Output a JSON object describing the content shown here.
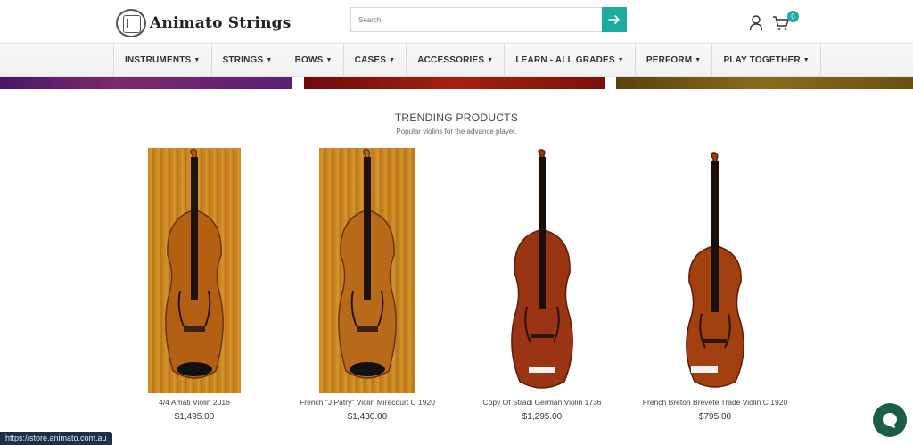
{
  "header": {
    "logo_text": "Animato Strings",
    "search_placeholder": "Search",
    "cart_count": "0"
  },
  "nav": {
    "items": [
      {
        "label": "INSTRUMENTS"
      },
      {
        "label": "STRINGS"
      },
      {
        "label": "BOWS"
      },
      {
        "label": "CASES"
      },
      {
        "label": "ACCESSORIES"
      },
      {
        "label": "LEARN - ALL GRADES"
      },
      {
        "label": "PERFORM"
      },
      {
        "label": "PLAY TOGETHER"
      }
    ]
  },
  "trending": {
    "title": "TRENDING PRODUCTS",
    "subtitle": "Popular violins for the advance player.",
    "products": [
      {
        "name": "4/4 Amati Violin 2016",
        "price": "$1,495.00"
      },
      {
        "name": "French \"J Patry\" Violin Mirecourt C 1920",
        "price": "$1,430.00"
      },
      {
        "name": "Copy Of Stradi German Violin 1736",
        "price": "$1,295.00"
      },
      {
        "name": "French Breton Brevete Trade Violin C 1920",
        "price": "$795.00"
      }
    ]
  },
  "status_bar": {
    "url": "https://store.animato.com.au"
  },
  "colors": {
    "accent": "#1eaaa1",
    "chat": "#1b5e46",
    "status_bg": "#1f2f4a"
  }
}
